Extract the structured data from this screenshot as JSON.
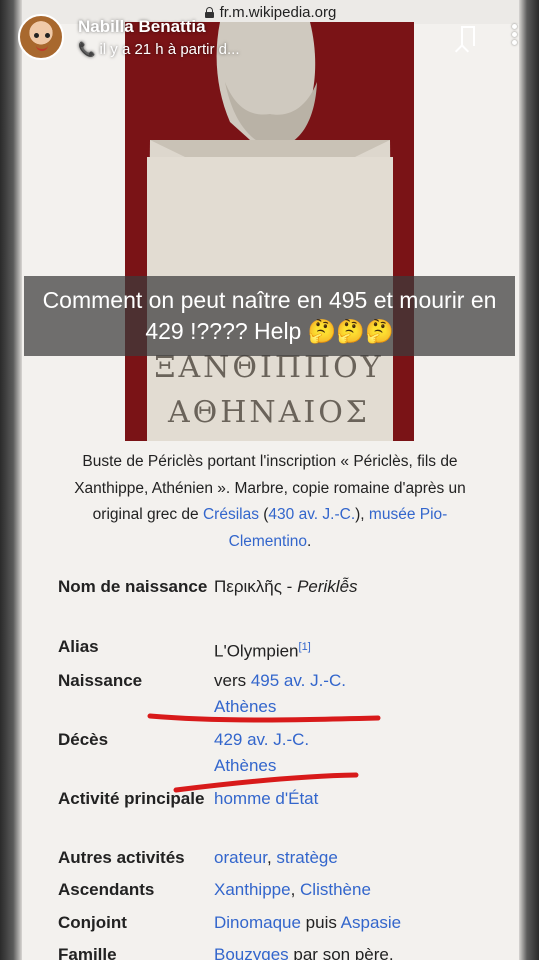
{
  "browser": {
    "url": "fr.m.wikipedia.org"
  },
  "snap": {
    "user_name": "Nabilla Benattia",
    "subtitle": "il y a 21 h à partir d...",
    "caption": "Comment on peut naître en 495 et mourir en 429 !???? Help 🤔🤔🤔"
  },
  "wiki": {
    "image_inscription": [
      "ΞΑΝΘΙΠΠΟΥ",
      "ΑΘΗΝΑΙΟΣ"
    ],
    "image_caption": {
      "text1": "Buste de Périclès portant l'inscription « Périclès, fils de Xanthippe, Athénien ». Marbre, copie romaine d'après un original grec de ",
      "link1": "Crésilas",
      "text2": " (",
      "link2": "430 av. J.-C.",
      "text3": "), ",
      "link3": "musée Pio-Clementino",
      "text4": "."
    },
    "infobox": {
      "birth_name_label": "Nom de naissance",
      "birth_name_value": "Περικλῆς",
      "birth_name_sep": " - ",
      "birth_name_translit": "Periklễs",
      "alias_label": "Alias",
      "alias_value": "L'Olympien",
      "alias_ref": "[1]",
      "birth_label": "Naissance",
      "birth_prefix": "vers ",
      "birth_date": "495 av. J.-C.",
      "birth_place": "Athènes",
      "death_label": "Décès",
      "death_date": "429 av. J.-C.",
      "death_place": "Athènes",
      "activity_label": "Activité principale",
      "activity_value": "homme d'État",
      "other_label": "Autres activités",
      "other_1": "orateur",
      "other_sep": ", ",
      "other_2": "stratège",
      "ancestors_label": "Ascendants",
      "ancestors_1": "Xanthippe",
      "ancestors_sep": ", ",
      "ancestors_2": "Clisthène",
      "spouse_label": "Conjoint",
      "spouse_1": "Dinomaque",
      "spouse_sep": " puis ",
      "spouse_2": "Aspasie",
      "family_label": "Famille",
      "family_link": "Bouzyges",
      "family_suffix": " par son père,"
    }
  },
  "colors": {
    "link": "#3366cc",
    "mark": "#d81a1a",
    "image_bg": "#7a1316"
  }
}
